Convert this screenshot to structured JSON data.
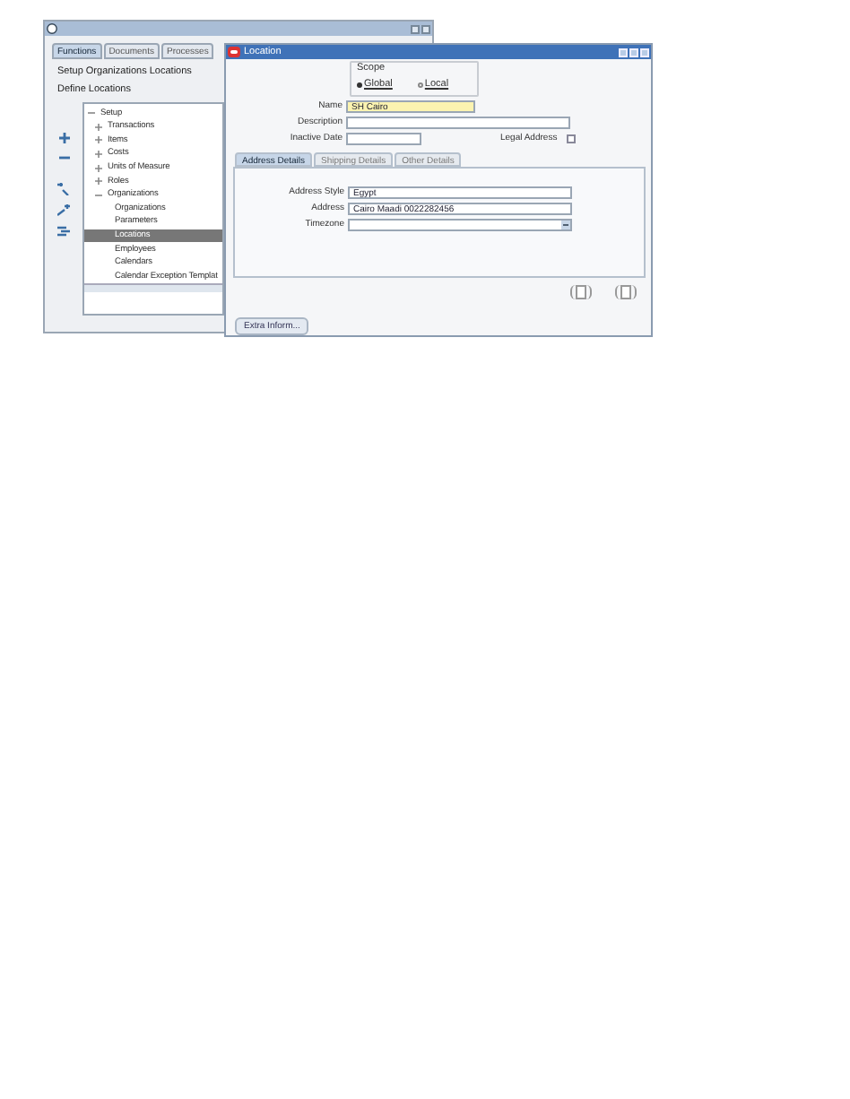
{
  "navigator": {
    "tabs": [
      {
        "label": "Functions",
        "selected": true
      },
      {
        "label": "Documents",
        "selected": false
      },
      {
        "label": "Processes",
        "selected": false
      }
    ],
    "path": "Setup Organizations Locations",
    "heading": "Define Locations",
    "tree": [
      {
        "label": "Setup",
        "expanded": true,
        "selected": false,
        "children": [
          {
            "label": "Transactions",
            "expanded": false,
            "selected": false
          },
          {
            "label": "Items",
            "expanded": false,
            "selected": false
          },
          {
            "label": "Costs",
            "expanded": false,
            "selected": false
          },
          {
            "label": "Units of Measure",
            "expanded": false,
            "selected": false
          },
          {
            "label": "Roles",
            "expanded": false,
            "selected": false
          },
          {
            "label": "Organizations",
            "expanded": true,
            "selected": false,
            "children": [
              {
                "label": "Organizations",
                "selected": false
              },
              {
                "label": "Parameters",
                "selected": false
              },
              {
                "label": "Locations",
                "selected": true
              },
              {
                "label": "Employees",
                "selected": false
              },
              {
                "label": "Calendars",
                "selected": false
              },
              {
                "label": "Calendar Exception Templat",
                "selected": false
              }
            ]
          }
        ]
      }
    ]
  },
  "location": {
    "title": "Location",
    "scope": {
      "label": "Scope",
      "options": [
        {
          "label": "Global",
          "selected": true
        },
        {
          "label": "Local",
          "selected": false
        }
      ]
    },
    "fields": [
      {
        "label": "Name",
        "value": "SH Cairo",
        "required": true
      },
      {
        "label": "Description",
        "required": false
      }
    ],
    "inactive_date": {
      "label": "Inactive Date"
    },
    "legal_address": {
      "label": "Legal Address",
      "checked": false
    },
    "tabs": [
      {
        "label": "Address Details",
        "selected": true
      },
      {
        "label": "Shipping Details",
        "selected": false
      },
      {
        "label": "Other Details",
        "selected": false
      }
    ],
    "address_fields": [
      {
        "label": "Address Style",
        "value": "Egypt",
        "kind": "text"
      },
      {
        "label": "Address",
        "value": "Cairo Maadi 0022282456",
        "kind": "text"
      },
      {
        "label": "Timezone",
        "kind": "list"
      }
    ],
    "extra_button": "Extra Inform..."
  }
}
